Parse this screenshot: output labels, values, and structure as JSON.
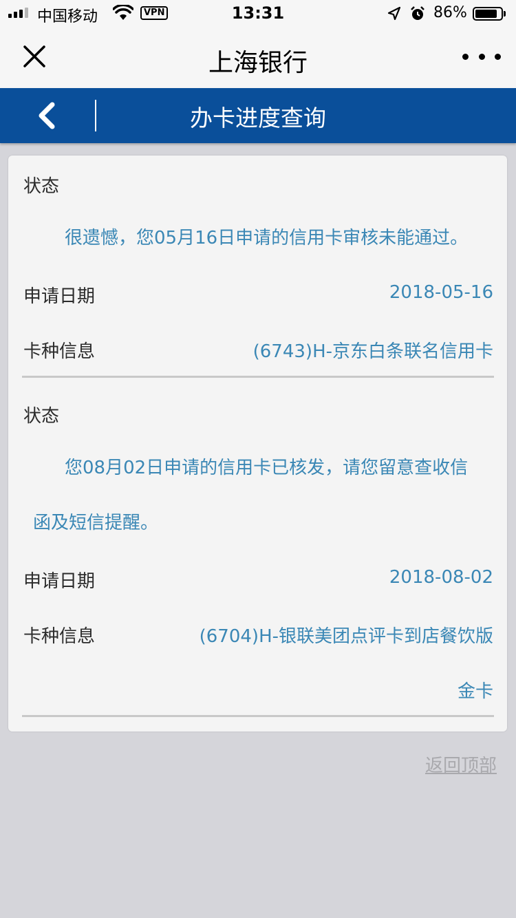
{
  "status_bar": {
    "carrier": "中国移动",
    "vpn": "VPN",
    "time": "13:31",
    "battery": "86%",
    "battery_level": 0.86
  },
  "nav": {
    "title": "上海银行",
    "close_icon": "close-icon",
    "more_icon": "more-icon"
  },
  "header": {
    "title": "办卡进度查询",
    "back_icon": "chevron-left-icon"
  },
  "records": [
    {
      "status_label": "状态",
      "status_lines": [
        "很遗憾，您05月16日申请的信用卡审核未能通过。"
      ],
      "date_label": "申请日期",
      "date": "2018-05-16",
      "card_label": "卡种信息",
      "card_lines": [
        "(6743)H-京东白条联名信用卡"
      ]
    },
    {
      "status_label": "状态",
      "status_lines": [
        "您08月02日申请的信用卡已核发，请您留意查收信",
        "函及短信提醒。"
      ],
      "date_label": "申请日期",
      "date": "2018-08-02",
      "card_label": "卡种信息",
      "card_lines": [
        "(6704)H-银联美团点评卡到店餐饮版",
        "金卡"
      ]
    }
  ],
  "footer": {
    "back_to_top": "返回顶部"
  },
  "colors": {
    "header_bg": "#0a4f9a",
    "value_text": "#3a87b5",
    "page_bg": "#d5d5da"
  }
}
